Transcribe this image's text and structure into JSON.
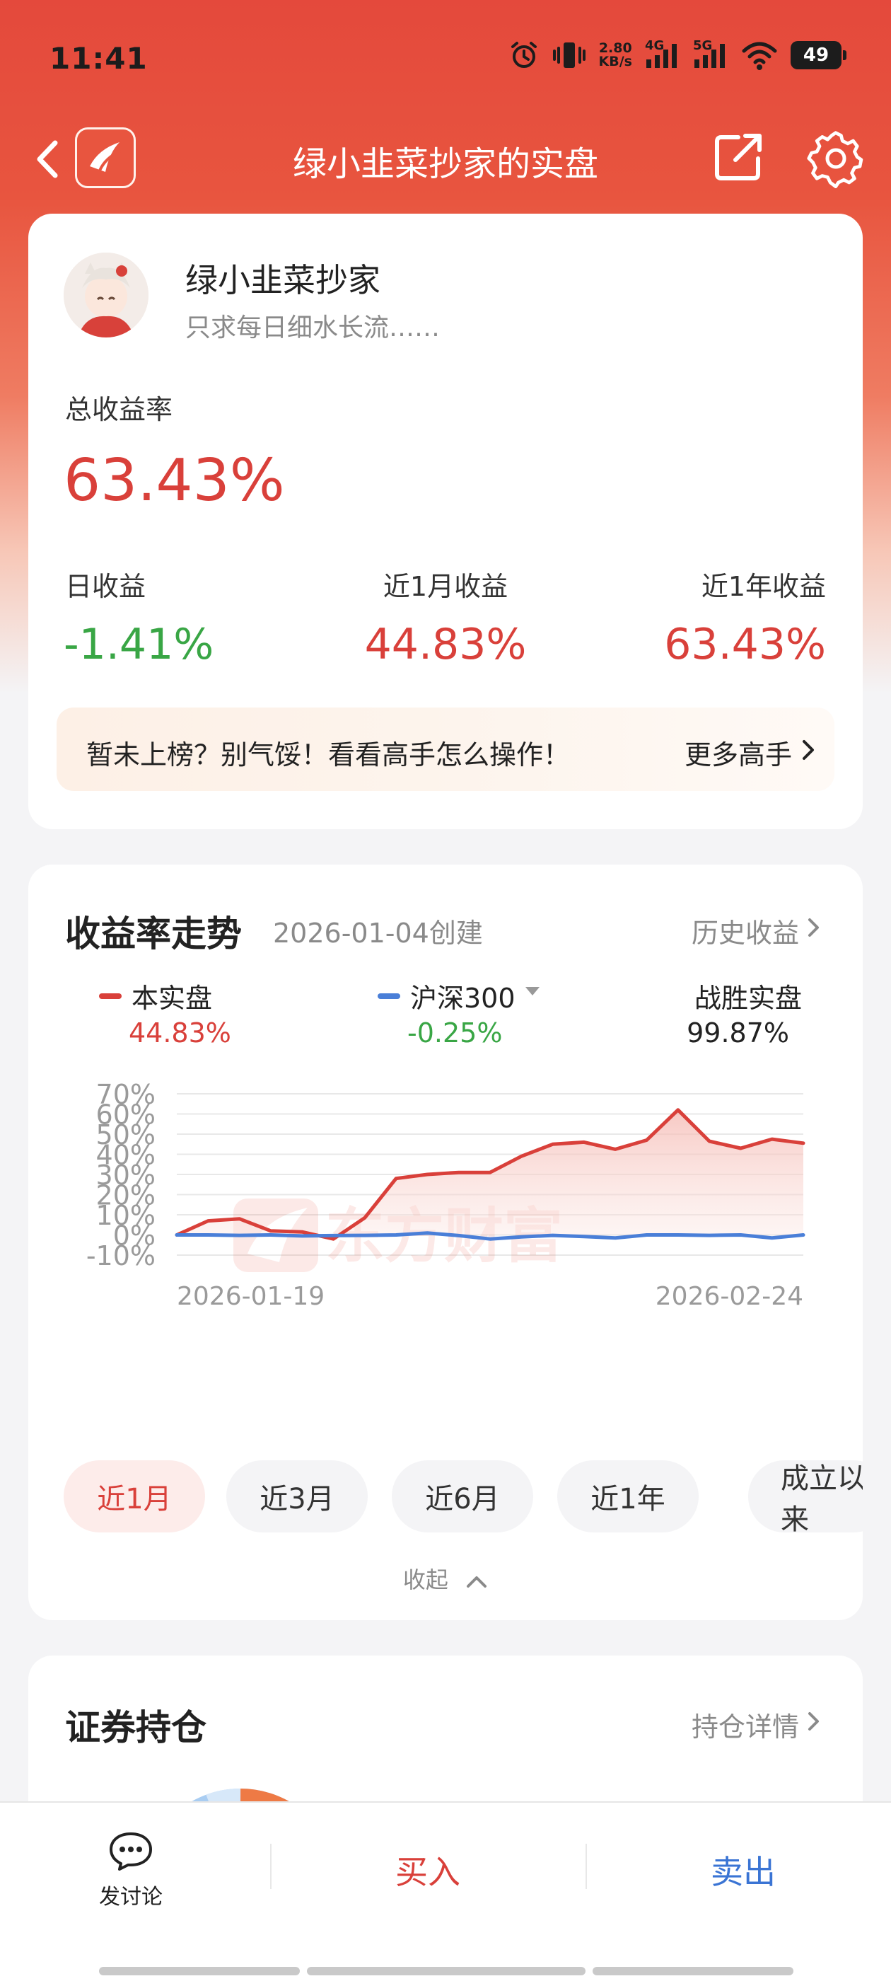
{
  "status_bar": {
    "time": "11:41",
    "net_speed_value": "2.80",
    "net_speed_unit": "KB/s",
    "signal_1": "4G",
    "signal_2": "5G",
    "battery": "49",
    "icons": [
      "alarm-icon",
      "vibrate-icon",
      "signal-4g-icon",
      "signal-5g-icon",
      "wifi-icon",
      "battery-icon"
    ]
  },
  "nav": {
    "title": "绿小韭菜抄家的实盘",
    "icons": [
      "back-icon",
      "app-logo-icon",
      "share-icon",
      "settings-icon"
    ]
  },
  "profile": {
    "name": "绿小韭菜抄家",
    "motto": "只求每日细水长流……",
    "total_label": "总收益率",
    "total_value": "63.43%",
    "stats": [
      {
        "label": "日收益",
        "value": "-1.41%"
      },
      {
        "label": "近1月收益",
        "value": "44.83%"
      },
      {
        "label": "近1年收益",
        "value": "63.43%"
      }
    ],
    "promo_text": "暂未上榜？别气馁！看看高手怎么操作！",
    "promo_more": "更多高手"
  },
  "chart_section": {
    "title": "收益率走势",
    "created": "2026-01-04创建",
    "history_link": "历史收益",
    "legend": [
      {
        "name": "本实盘",
        "value": "44.83%",
        "color": "#d9403a"
      },
      {
        "name": "沪深300",
        "value": "-0.25%",
        "color": "#4a7fd8"
      },
      {
        "name": "战胜实盘",
        "value": "99.87%"
      }
    ],
    "periods": [
      "近1月",
      "近3月",
      "近6月",
      "近1年",
      "成立以来"
    ],
    "active_period": "近1月",
    "collapse_label": "收起"
  },
  "chart_data": {
    "type": "line",
    "x_labels": [
      "2026-01-19",
      "2026-02-24"
    ],
    "y_ticks": [
      "70%",
      "60%",
      "50%",
      "40%",
      "30%",
      "20%",
      "10%",
      "0%",
      "-10%"
    ],
    "ylim": [
      -10,
      70
    ],
    "grid": true,
    "series": [
      {
        "name": "本实盘",
        "color": "#d9403a",
        "area": true,
        "values": [
          0,
          7,
          8,
          2,
          1.5,
          -2,
          8.5,
          28,
          30,
          31,
          31,
          39,
          45,
          46,
          42.5,
          47,
          62,
          46.5,
          43,
          47.5,
          45.5
        ]
      },
      {
        "name": "沪深300",
        "color": "#4a7fd8",
        "area": false,
        "values": [
          0,
          0,
          -0.2,
          0,
          -0.5,
          -0.3,
          -0.2,
          0,
          1,
          -0.3,
          -2,
          -1,
          -0.2,
          -0.8,
          -1.5,
          0,
          0,
          -0.2,
          0,
          -1.5,
          0
        ]
      }
    ]
  },
  "holdings": {
    "title": "证券持仓",
    "detail_link": "持仓详情"
  },
  "bottom": {
    "discuss_label": "发讨论",
    "buy_label": "买入",
    "sell_label": "卖出"
  }
}
